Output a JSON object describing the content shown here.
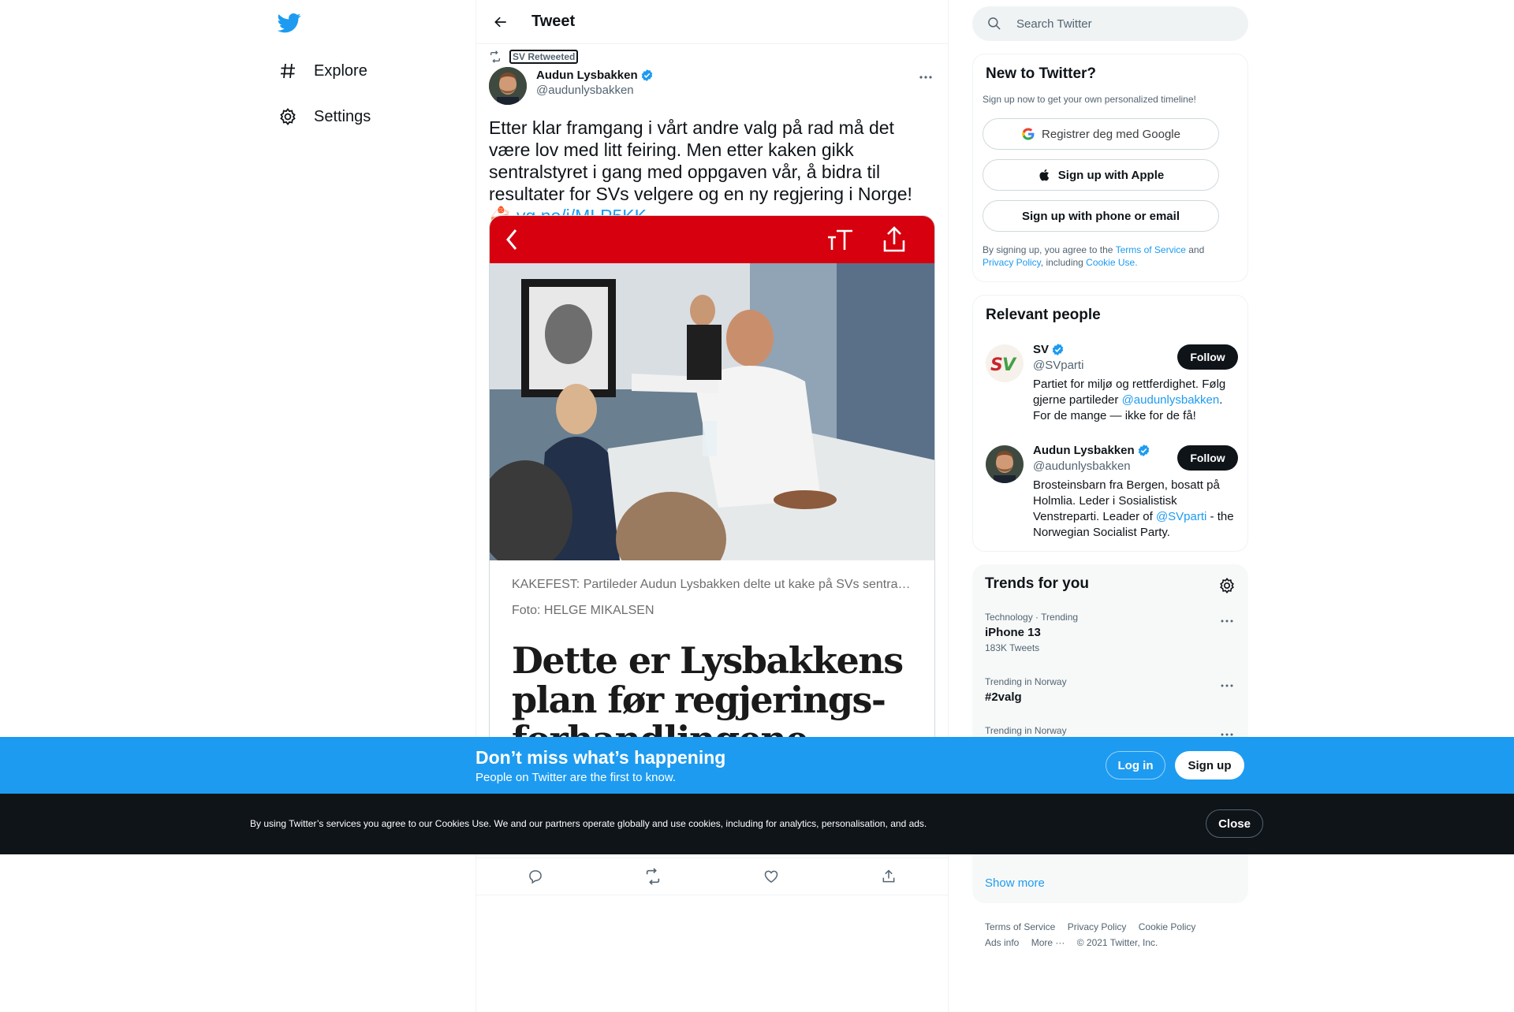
{
  "colors": {
    "brand": "#1d9bf0",
    "text": "#0f1419",
    "secondary": "#536471",
    "vg_red": "#d6000e"
  },
  "nav": {
    "logo_icon": "twitter-bird-icon",
    "items": [
      {
        "label": "Explore",
        "icon": "hashtag-icon"
      },
      {
        "label": "Settings",
        "icon": "gear-icon"
      }
    ]
  },
  "main": {
    "title": "Tweet",
    "retweeted_by": "SV Retweeted",
    "tweet": {
      "author_name": "Audun Lysbakken",
      "author_handle": "@audunlysbakken",
      "text": "Etter klar framgang i vårt andre valg på rad må det være lov med litt feiring. Men etter kaken gikk sentralstyret i gang med oppgaven vår, å bidra til resultater for SVs velgere og en ny regjering i Norge! 🍰",
      "link": "vg.no/i/MLP5KK",
      "media": {
        "caption": "KAKEFEST: Partileder Audun Lysbakken delte ut kake på SVs sentralstyremøte.",
        "photo_credit": "Foto: HELGE MIKALSEN",
        "headline": "Dette er Lysbakkens plan før regjerings-forhandlingene"
      }
    },
    "actions": [
      "reply-icon",
      "retweet-icon",
      "like-icon",
      "share-icon"
    ]
  },
  "sidebar": {
    "search_placeholder": "Search Twitter",
    "new_to_twitter": {
      "title": "New to Twitter?",
      "subtitle": "Sign up now to get your own personalized timeline!",
      "google": "Registrer deg med Google",
      "apple": "Sign up with Apple",
      "phone": "Sign up with phone or email",
      "terms_prefix": "By signing up, you agree to the ",
      "terms_link": "Terms of Service",
      "terms_and": " and ",
      "privacy_link": "Privacy Policy",
      "including": ", including ",
      "cookie_link": "Cookie Use."
    },
    "relevant_people": {
      "title": "Relevant people",
      "follow_label": "Follow",
      "people": [
        {
          "name": "SV",
          "handle": "@SVparti",
          "bio_before": "Partiet for miljø og rettferdighet. Følg gjerne partileder ",
          "bio_link": "@audunlysbakken",
          "bio_after": ". For de mange — ikke for de få!"
        },
        {
          "name": "Audun Lysbakken",
          "handle": "@audunlysbakken",
          "bio_before": "Brosteinsbarn fra Bergen, bosatt på Holmlia. Leder i Sosialistisk Venstreparti. Leader of ",
          "bio_link": "@SVparti",
          "bio_after": " - the Norwegian Socialist Party."
        }
      ]
    },
    "trends": {
      "title": "Trends for you",
      "items": [
        {
          "meta": "Technology · Trending",
          "name": "iPhone 13",
          "count": "183K Tweets"
        },
        {
          "meta": "Trending in Norway",
          "name": "#2valg",
          "count": ""
        },
        {
          "meta": "Trending in Norway",
          "name": "",
          "count": ""
        }
      ],
      "show_more": "Show more"
    },
    "footer": {
      "terms": "Terms of Service",
      "privacy": "Privacy Policy",
      "cookie": "Cookie Policy",
      "ads": "Ads info",
      "more": "More ···",
      "copyright": "© 2021 Twitter, Inc."
    }
  },
  "signup_bar": {
    "title": "Don’t miss what’s happening",
    "subtitle": "People on Twitter are the first to know.",
    "login": "Log in",
    "signup": "Sign up"
  },
  "cookie_bar": {
    "text": "By using Twitter’s services you agree to our Cookies Use. We and our partners operate globally and use cookies, including for analytics, personalisation, and ads.",
    "close": "Close"
  }
}
